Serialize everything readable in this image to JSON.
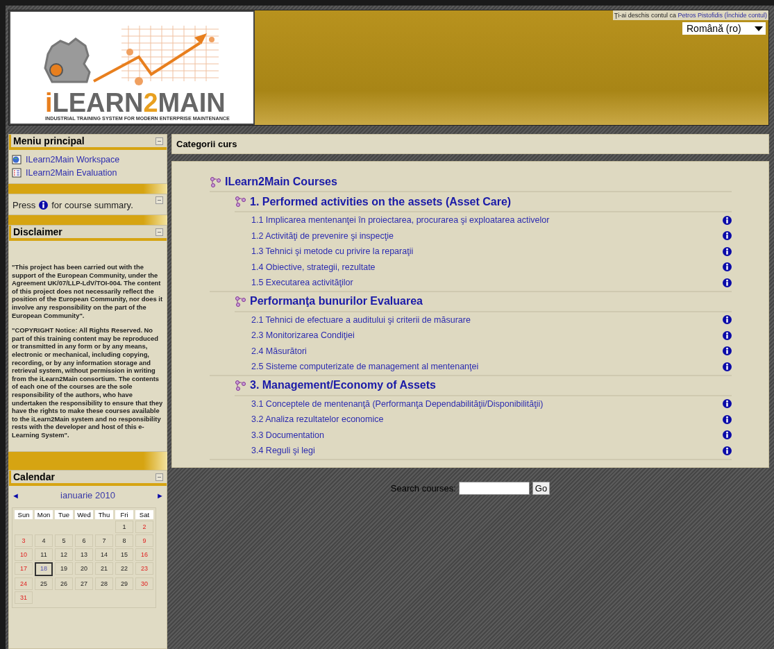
{
  "header": {
    "logo": {
      "wordmark": "iLEARN2MAIN",
      "tagline": "INDUSTRIAL TRAINING SYSTEM FOR MODERN ENTERPRISE MAINTENANCE"
    },
    "login": {
      "prefix": "Ţi-ai deschis contul ca",
      "user": "Petros Pistofidis",
      "logout": "(Închide contul)"
    },
    "language": {
      "value": "Română (ro)"
    }
  },
  "sidebar": {
    "blocks": [
      {
        "kind": "menu",
        "title": "Meniu principal",
        "items": [
          {
            "label": "ILearn2Main Workspace"
          },
          {
            "label": "ILearn2Main Evaluation"
          }
        ]
      },
      {
        "kind": "hint",
        "before": "Press",
        "after": "for course summary."
      },
      {
        "kind": "text",
        "title": "Disclaimer",
        "paragraphs": [
          "\"This project has been carried out with the support of the European Community, under the Agreement UK/07/LLP-LdV/TOI-004. The content of this project does not necessarily reflect the position of the European Community, nor does it involve any responsibility on the part of the European Community\".",
          "\"COPYRIGHT Notice: All Rights Reserved. No part of this training content may be reproduced or transmitted in any form or by any means, electronic or mechanical, including copying, recording, or by any information storage and retrieval system, without permission in writing from the iLearn2Main consortium. The contents of each one of the courses are the sole responsibility of the authors, who have undertaken the responsibility to ensure that they have the rights to make these courses available to the iLearn2Main system and no responsibility rests with the developer and host of this e-Learning System\"."
        ]
      },
      {
        "kind": "calendar",
        "title": "Calendar",
        "prev": "◄",
        "month": "ianuarie 2010",
        "next": "►",
        "weekdays": [
          "Sun",
          "Mon",
          "Tue",
          "Wed",
          "Thu",
          "Fri",
          "Sat"
        ],
        "weeks": [
          [
            {
              "kind": "empty"
            },
            {
              "kind": "empty"
            },
            {
              "kind": "empty"
            },
            {
              "kind": "empty"
            },
            {
              "kind": "empty"
            },
            {
              "kind": "day",
              "day": "1",
              "weekend": false,
              "today": false
            },
            {
              "kind": "day",
              "day": "2",
              "weekend": true,
              "today": false
            }
          ],
          [
            {
              "kind": "day",
              "day": "3",
              "weekend": true,
              "today": false
            },
            {
              "kind": "day",
              "day": "4",
              "weekend": false,
              "today": false
            },
            {
              "kind": "day",
              "day": "5",
              "weekend": false,
              "today": false
            },
            {
              "kind": "day",
              "day": "6",
              "weekend": false,
              "today": false
            },
            {
              "kind": "day",
              "day": "7",
              "weekend": false,
              "today": false
            },
            {
              "kind": "day",
              "day": "8",
              "weekend": false,
              "today": false
            },
            {
              "kind": "day",
              "day": "9",
              "weekend": true,
              "today": false
            }
          ],
          [
            {
              "kind": "day",
              "day": "10",
              "weekend": true,
              "today": false
            },
            {
              "kind": "day",
              "day": "11",
              "weekend": false,
              "today": false
            },
            {
              "kind": "day",
              "day": "12",
              "weekend": false,
              "today": false
            },
            {
              "kind": "day",
              "day": "13",
              "weekend": false,
              "today": false
            },
            {
              "kind": "day",
              "day": "14",
              "weekend": false,
              "today": false
            },
            {
              "kind": "day",
              "day": "15",
              "weekend": false,
              "today": false
            },
            {
              "kind": "day",
              "day": "16",
              "weekend": true,
              "today": false
            }
          ],
          [
            {
              "kind": "day",
              "day": "17",
              "weekend": true,
              "today": false
            },
            {
              "kind": "day",
              "day": "18",
              "weekend": false,
              "today": true
            },
            {
              "kind": "day",
              "day": "19",
              "weekend": false,
              "today": false
            },
            {
              "kind": "day",
              "day": "20",
              "weekend": false,
              "today": false
            },
            {
              "kind": "day",
              "day": "21",
              "weekend": false,
              "today": false
            },
            {
              "kind": "day",
              "day": "22",
              "weekend": false,
              "today": false
            },
            {
              "kind": "day",
              "day": "23",
              "weekend": true,
              "today": false
            }
          ],
          [
            {
              "kind": "day",
              "day": "24",
              "weekend": true,
              "today": false
            },
            {
              "kind": "day",
              "day": "25",
              "weekend": false,
              "today": false
            },
            {
              "kind": "day",
              "day": "26",
              "weekend": false,
              "today": false
            },
            {
              "kind": "day",
              "day": "27",
              "weekend": false,
              "today": false
            },
            {
              "kind": "day",
              "day": "28",
              "weekend": false,
              "today": false
            },
            {
              "kind": "day",
              "day": "29",
              "weekend": false,
              "today": false
            },
            {
              "kind": "day",
              "day": "30",
              "weekend": true,
              "today": false
            }
          ],
          [
            {
              "kind": "day",
              "day": "31",
              "weekend": true,
              "today": false
            }
          ]
        ]
      }
    ]
  },
  "main": {
    "title": "Categorii curs",
    "tree": {
      "kind": "category",
      "title": "ILearn2Main Courses",
      "children": [
        {
          "kind": "category",
          "title": "1. Performed activities on the assets (Asset Care)",
          "children": [
            {
              "kind": "course",
              "title": "1.1 Implicarea mentenanţei în proiectarea, procurarea şi exploatarea activelor"
            },
            {
              "kind": "course",
              "title": "1.2 Activităţi de prevenire şi inspecţie"
            },
            {
              "kind": "course",
              "title": "1.3 Tehnici şi metode cu privire la reparaţii"
            },
            {
              "kind": "course",
              "title": "1.4 Obiective, strategii, rezultate"
            },
            {
              "kind": "course",
              "title": "1.5 Executarea activităţilor"
            }
          ]
        },
        {
          "kind": "category",
          "title": "Performanţa bunurilor Evaluarea",
          "children": [
            {
              "kind": "course",
              "title": "2.1 Tehnici de efectuare a auditului şi criterii de măsurare"
            },
            {
              "kind": "course",
              "title": "2.3 Monitorizarea Condiţiei"
            },
            {
              "kind": "course",
              "title": "2.4 Măsurători"
            },
            {
              "kind": "course",
              "title": "2.5 Sisteme computerizate de management al mentenanţei"
            }
          ]
        },
        {
          "kind": "category",
          "title": "3. Management/Economy of Assets",
          "children": [
            {
              "kind": "course",
              "title": "3.1 Conceptele de mentenanţă (Performanţa Dependabilităţii/Disponibilităţii)"
            },
            {
              "kind": "course",
              "title": "3.2 Analiza rezultatelor economice"
            },
            {
              "kind": "course",
              "title": "3.3 Documentation"
            },
            {
              "kind": "course",
              "title": "3.4 Reguli şi legi"
            }
          ]
        }
      ]
    },
    "search": {
      "label": "Search courses:",
      "button": "Go"
    }
  }
}
